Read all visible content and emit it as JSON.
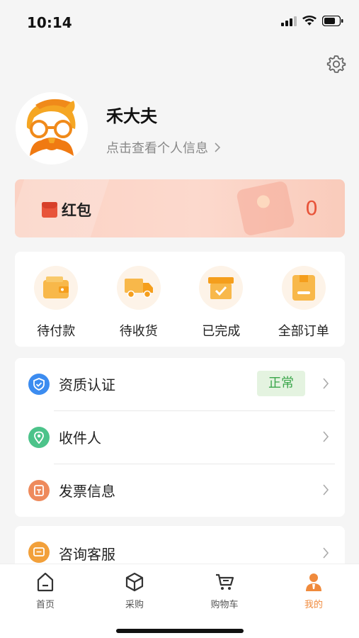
{
  "status_bar": {
    "time": "10:14"
  },
  "profile": {
    "name": "禾大夫",
    "subtitle": "点击查看个人信息"
  },
  "red_packet": {
    "label": "红包",
    "value": "0"
  },
  "orders": [
    {
      "label": "待付款",
      "icon": "wallet-icon"
    },
    {
      "label": "待收货",
      "icon": "truck-icon"
    },
    {
      "label": "已完成",
      "icon": "box-check-icon"
    },
    {
      "label": "全部订单",
      "icon": "order-list-icon"
    }
  ],
  "menu": [
    {
      "label": "资质认证",
      "icon": "shield-icon",
      "color": "#3c8cf0",
      "badge": "正常"
    },
    {
      "label": "收件人",
      "icon": "location-icon",
      "color": "#4cc38a"
    },
    {
      "label": "发票信息",
      "icon": "invoice-icon",
      "color": "#ee8a5c"
    },
    {
      "label": "咨询客服",
      "icon": "chat-icon",
      "color": "#f2a03a"
    }
  ],
  "tabbar": [
    {
      "label": "首页",
      "icon": "home-icon"
    },
    {
      "label": "采购",
      "icon": "cube-icon"
    },
    {
      "label": "购物车",
      "icon": "cart-icon"
    },
    {
      "label": "我的",
      "icon": "user-icon",
      "active": true
    }
  ],
  "colors": {
    "accent": "#f08a3c",
    "red": "#e8543a",
    "badge_green": "#3aa64a"
  }
}
